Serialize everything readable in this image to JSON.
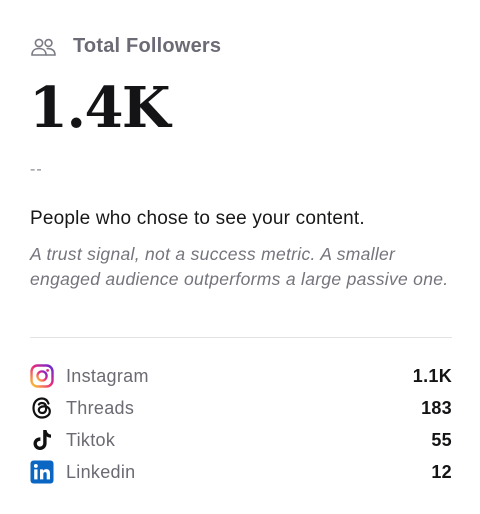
{
  "header": {
    "icon": "users-icon",
    "title": "Total Followers"
  },
  "metric": {
    "value": "1.4K",
    "delta": "--"
  },
  "description": {
    "headline": "People who chose to see your content.",
    "note": "A trust signal, not a success metric. A smaller engaged audience outperforms a large passive one."
  },
  "platforms": [
    {
      "name": "Instagram",
      "count": "1.1K",
      "icon": "instagram-icon"
    },
    {
      "name": "Threads",
      "count": "183",
      "icon": "threads-icon"
    },
    {
      "name": "Tiktok",
      "count": "55",
      "icon": "tiktok-icon"
    },
    {
      "name": "Linkedin",
      "count": "12",
      "icon": "linkedin-icon"
    }
  ],
  "colors": {
    "linkedin": "#0a66c2",
    "instagram_gradient": [
      "#f9ce34",
      "#ee2a7b",
      "#6228d7"
    ],
    "muted_text": "#6b6b76"
  }
}
